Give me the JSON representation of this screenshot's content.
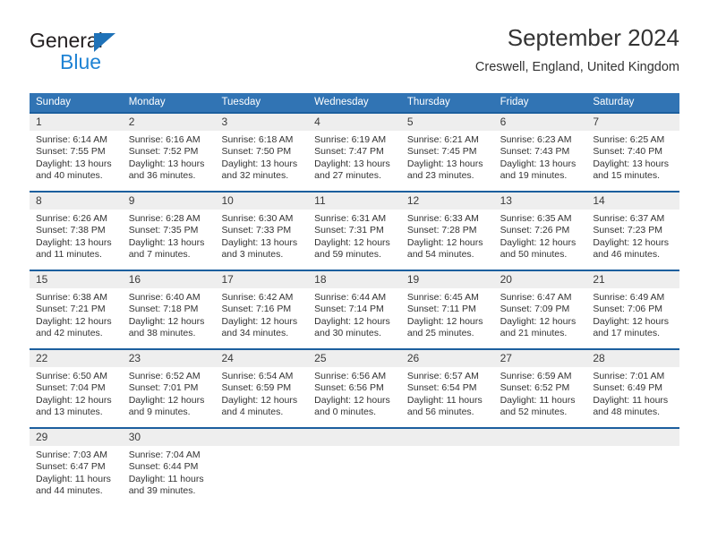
{
  "brand": {
    "name_part1": "General",
    "name_part2": "Blue",
    "triangle_icon": "triangle-icon",
    "color_dark": "#231f20",
    "color_blue": "#1f83d4",
    "triangle_color": "#1f72b8"
  },
  "header": {
    "title": "September 2024",
    "subtitle": "Creswell, England, United Kingdom"
  },
  "theme": {
    "header_bg": "#3174b4",
    "row_divider": "#1c5f9e",
    "day_band_bg": "#eeeeee",
    "text": "#333333"
  },
  "weekdays": [
    "Sunday",
    "Monday",
    "Tuesday",
    "Wednesday",
    "Thursday",
    "Friday",
    "Saturday"
  ],
  "weeks": [
    [
      {
        "day": "1",
        "sunrise": "Sunrise: 6:14 AM",
        "sunset": "Sunset: 7:55 PM",
        "daylight1": "Daylight: 13 hours",
        "daylight2": "and 40 minutes."
      },
      {
        "day": "2",
        "sunrise": "Sunrise: 6:16 AM",
        "sunset": "Sunset: 7:52 PM",
        "daylight1": "Daylight: 13 hours",
        "daylight2": "and 36 minutes."
      },
      {
        "day": "3",
        "sunrise": "Sunrise: 6:18 AM",
        "sunset": "Sunset: 7:50 PM",
        "daylight1": "Daylight: 13 hours",
        "daylight2": "and 32 minutes."
      },
      {
        "day": "4",
        "sunrise": "Sunrise: 6:19 AM",
        "sunset": "Sunset: 7:47 PM",
        "daylight1": "Daylight: 13 hours",
        "daylight2": "and 27 minutes."
      },
      {
        "day": "5",
        "sunrise": "Sunrise: 6:21 AM",
        "sunset": "Sunset: 7:45 PM",
        "daylight1": "Daylight: 13 hours",
        "daylight2": "and 23 minutes."
      },
      {
        "day": "6",
        "sunrise": "Sunrise: 6:23 AM",
        "sunset": "Sunset: 7:43 PM",
        "daylight1": "Daylight: 13 hours",
        "daylight2": "and 19 minutes."
      },
      {
        "day": "7",
        "sunrise": "Sunrise: 6:25 AM",
        "sunset": "Sunset: 7:40 PM",
        "daylight1": "Daylight: 13 hours",
        "daylight2": "and 15 minutes."
      }
    ],
    [
      {
        "day": "8",
        "sunrise": "Sunrise: 6:26 AM",
        "sunset": "Sunset: 7:38 PM",
        "daylight1": "Daylight: 13 hours",
        "daylight2": "and 11 minutes."
      },
      {
        "day": "9",
        "sunrise": "Sunrise: 6:28 AM",
        "sunset": "Sunset: 7:35 PM",
        "daylight1": "Daylight: 13 hours",
        "daylight2": "and 7 minutes."
      },
      {
        "day": "10",
        "sunrise": "Sunrise: 6:30 AM",
        "sunset": "Sunset: 7:33 PM",
        "daylight1": "Daylight: 13 hours",
        "daylight2": "and 3 minutes."
      },
      {
        "day": "11",
        "sunrise": "Sunrise: 6:31 AM",
        "sunset": "Sunset: 7:31 PM",
        "daylight1": "Daylight: 12 hours",
        "daylight2": "and 59 minutes."
      },
      {
        "day": "12",
        "sunrise": "Sunrise: 6:33 AM",
        "sunset": "Sunset: 7:28 PM",
        "daylight1": "Daylight: 12 hours",
        "daylight2": "and 54 minutes."
      },
      {
        "day": "13",
        "sunrise": "Sunrise: 6:35 AM",
        "sunset": "Sunset: 7:26 PM",
        "daylight1": "Daylight: 12 hours",
        "daylight2": "and 50 minutes."
      },
      {
        "day": "14",
        "sunrise": "Sunrise: 6:37 AM",
        "sunset": "Sunset: 7:23 PM",
        "daylight1": "Daylight: 12 hours",
        "daylight2": "and 46 minutes."
      }
    ],
    [
      {
        "day": "15",
        "sunrise": "Sunrise: 6:38 AM",
        "sunset": "Sunset: 7:21 PM",
        "daylight1": "Daylight: 12 hours",
        "daylight2": "and 42 minutes."
      },
      {
        "day": "16",
        "sunrise": "Sunrise: 6:40 AM",
        "sunset": "Sunset: 7:18 PM",
        "daylight1": "Daylight: 12 hours",
        "daylight2": "and 38 minutes."
      },
      {
        "day": "17",
        "sunrise": "Sunrise: 6:42 AM",
        "sunset": "Sunset: 7:16 PM",
        "daylight1": "Daylight: 12 hours",
        "daylight2": "and 34 minutes."
      },
      {
        "day": "18",
        "sunrise": "Sunrise: 6:44 AM",
        "sunset": "Sunset: 7:14 PM",
        "daylight1": "Daylight: 12 hours",
        "daylight2": "and 30 minutes."
      },
      {
        "day": "19",
        "sunrise": "Sunrise: 6:45 AM",
        "sunset": "Sunset: 7:11 PM",
        "daylight1": "Daylight: 12 hours",
        "daylight2": "and 25 minutes."
      },
      {
        "day": "20",
        "sunrise": "Sunrise: 6:47 AM",
        "sunset": "Sunset: 7:09 PM",
        "daylight1": "Daylight: 12 hours",
        "daylight2": "and 21 minutes."
      },
      {
        "day": "21",
        "sunrise": "Sunrise: 6:49 AM",
        "sunset": "Sunset: 7:06 PM",
        "daylight1": "Daylight: 12 hours",
        "daylight2": "and 17 minutes."
      }
    ],
    [
      {
        "day": "22",
        "sunrise": "Sunrise: 6:50 AM",
        "sunset": "Sunset: 7:04 PM",
        "daylight1": "Daylight: 12 hours",
        "daylight2": "and 13 minutes."
      },
      {
        "day": "23",
        "sunrise": "Sunrise: 6:52 AM",
        "sunset": "Sunset: 7:01 PM",
        "daylight1": "Daylight: 12 hours",
        "daylight2": "and 9 minutes."
      },
      {
        "day": "24",
        "sunrise": "Sunrise: 6:54 AM",
        "sunset": "Sunset: 6:59 PM",
        "daylight1": "Daylight: 12 hours",
        "daylight2": "and 4 minutes."
      },
      {
        "day": "25",
        "sunrise": "Sunrise: 6:56 AM",
        "sunset": "Sunset: 6:56 PM",
        "daylight1": "Daylight: 12 hours",
        "daylight2": "and 0 minutes."
      },
      {
        "day": "26",
        "sunrise": "Sunrise: 6:57 AM",
        "sunset": "Sunset: 6:54 PM",
        "daylight1": "Daylight: 11 hours",
        "daylight2": "and 56 minutes."
      },
      {
        "day": "27",
        "sunrise": "Sunrise: 6:59 AM",
        "sunset": "Sunset: 6:52 PM",
        "daylight1": "Daylight: 11 hours",
        "daylight2": "and 52 minutes."
      },
      {
        "day": "28",
        "sunrise": "Sunrise: 7:01 AM",
        "sunset": "Sunset: 6:49 PM",
        "daylight1": "Daylight: 11 hours",
        "daylight2": "and 48 minutes."
      }
    ],
    [
      {
        "day": "29",
        "sunrise": "Sunrise: 7:03 AM",
        "sunset": "Sunset: 6:47 PM",
        "daylight1": "Daylight: 11 hours",
        "daylight2": "and 44 minutes."
      },
      {
        "day": "30",
        "sunrise": "Sunrise: 7:04 AM",
        "sunset": "Sunset: 6:44 PM",
        "daylight1": "Daylight: 11 hours",
        "daylight2": "and 39 minutes."
      },
      {
        "day": "",
        "sunrise": "",
        "sunset": "",
        "daylight1": "",
        "daylight2": ""
      },
      {
        "day": "",
        "sunrise": "",
        "sunset": "",
        "daylight1": "",
        "daylight2": ""
      },
      {
        "day": "",
        "sunrise": "",
        "sunset": "",
        "daylight1": "",
        "daylight2": ""
      },
      {
        "day": "",
        "sunrise": "",
        "sunset": "",
        "daylight1": "",
        "daylight2": ""
      },
      {
        "day": "",
        "sunrise": "",
        "sunset": "",
        "daylight1": "",
        "daylight2": ""
      }
    ]
  ]
}
